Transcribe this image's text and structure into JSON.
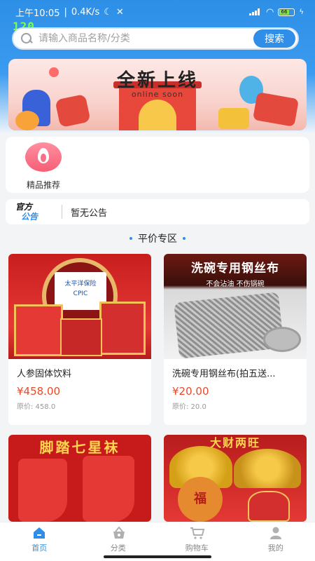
{
  "status_bar": {
    "time": "上午10:05",
    "speed": "0.4K/s",
    "battery": "66"
  },
  "fps": "120",
  "search": {
    "placeholder": "请输入商品名称/分类",
    "button": "搜索"
  },
  "banner": {
    "title": "全新上线",
    "subtitle": "online soon"
  },
  "categories": [
    {
      "label": "精品推荐",
      "icon": "flame-icon"
    }
  ],
  "notice": {
    "logo_top": "官方",
    "logo_bottom": "公告",
    "text": "暂无公告"
  },
  "section": {
    "title": "平价专区"
  },
  "products": [
    {
      "name": "人参固体饮料",
      "price": "¥458.00",
      "orig": "原价: 458.0",
      "image_text": "太平洋保险",
      "image_sub": "CPIC"
    },
    {
      "name": "洗碗专用钢丝布(拍五送...",
      "price": "¥20.00",
      "orig": "原价: 20.0",
      "image_text": "洗碗专用钢丝布",
      "image_sub": "不会沾油  不伤锅碗"
    },
    {
      "name": "",
      "price": "",
      "orig": "",
      "image_text": "脚踏七星袜",
      "image_sub": ""
    },
    {
      "name": "",
      "price": "",
      "orig": "",
      "image_text": "大财两旺",
      "image_sub": "福"
    }
  ],
  "tabs": [
    {
      "label": "首页",
      "icon": "home-icon",
      "active": true
    },
    {
      "label": "分类",
      "icon": "category-basket-icon",
      "active": false
    },
    {
      "label": "购物车",
      "icon": "cart-icon",
      "active": false
    },
    {
      "label": "我的",
      "icon": "user-icon",
      "active": false
    }
  ],
  "colors": {
    "primary": "#2f8fe8",
    "price": "#e84a2a"
  }
}
